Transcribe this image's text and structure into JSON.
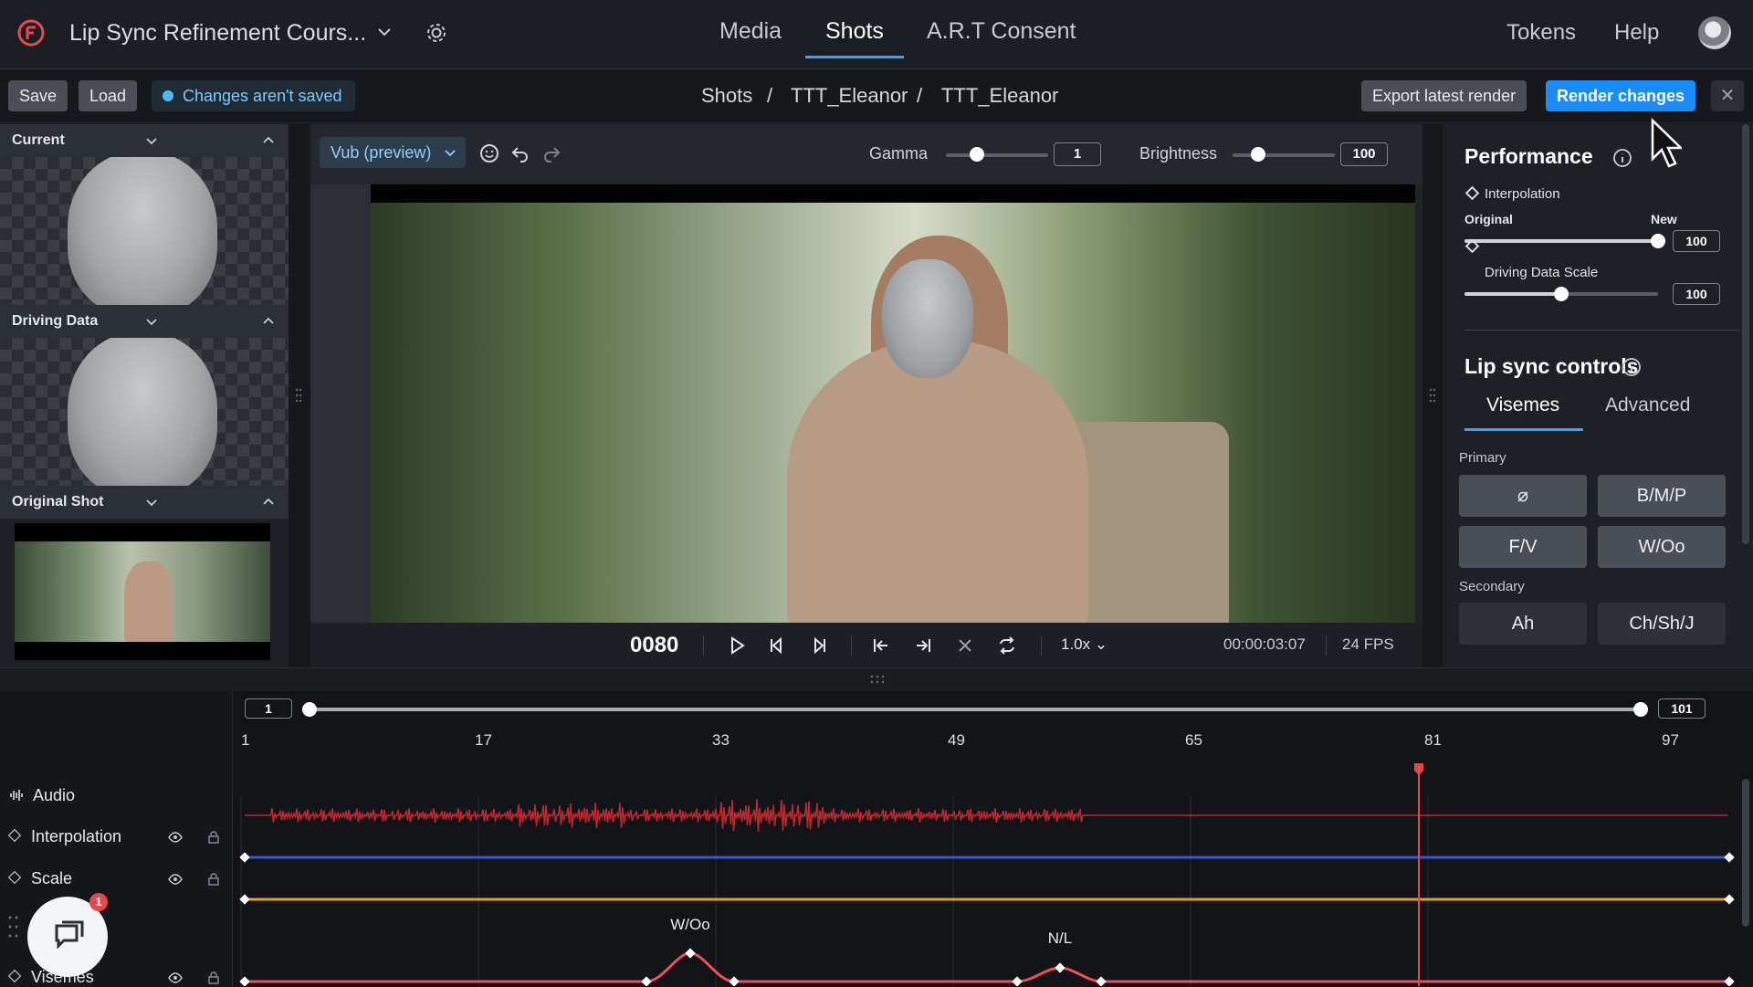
{
  "app": {
    "project_title": "Lip Sync Refinement Cours...",
    "nav_tabs": [
      "Media",
      "Shots",
      "A.R.T Consent"
    ],
    "active_tab": "Shots",
    "tokens_label": "Tokens",
    "help_label": "Help"
  },
  "toolbar": {
    "save_label": "Save",
    "load_label": "Load",
    "status_text": "Changes aren't saved",
    "breadcrumb": [
      "Shots",
      "TTT_Eleanor",
      "TTT_Eleanor"
    ],
    "breadcrumb_sep": "/",
    "export_label": "Export latest render",
    "render_label": "Render changes",
    "close_label": "✕"
  },
  "left_panel": {
    "sections": [
      "Current",
      "Driving Data",
      "Original Shot"
    ]
  },
  "viewer": {
    "mode_label": "Vub (preview)",
    "gamma_label": "Gamma",
    "gamma_value": "1",
    "gamma_level": 0.3,
    "brightness_label": "Brightness",
    "brightness_value": "100",
    "brightness_level": 0.25,
    "frame": "0080",
    "speed": "1.0x",
    "timecode": "00:00:03:07",
    "fps": "24 FPS"
  },
  "performance": {
    "title": "Performance",
    "interpolation_label": "Interpolation",
    "original_label": "Original",
    "new_label": "New",
    "interpolation_value": "100",
    "interpolation_level": 1.0,
    "driving_label": "Driving Data Scale",
    "driving_value": "100",
    "driving_level": 0.5
  },
  "lipsync": {
    "title": "Lip sync controls",
    "tabs": [
      "Visemes",
      "Advanced"
    ],
    "active_tab": "Visemes",
    "primary_label": "Primary",
    "primary_buttons": [
      "⌀",
      "B/M/P",
      "F/V",
      "W/Oo"
    ],
    "secondary_label": "Secondary",
    "secondary_buttons": [
      "Ah",
      "Ch/Sh/J"
    ]
  },
  "timeline": {
    "range_start": "1",
    "range_end": "101",
    "ticks": [
      "1",
      "17",
      "33",
      "49",
      "65",
      "81",
      "97"
    ],
    "tracks": [
      "Audio",
      "Interpolation",
      "Scale",
      "Visemes"
    ],
    "viseme_marks": [
      "W/Oo",
      "N/L"
    ],
    "notification_count": "1",
    "colors": {
      "audio": "#c0282d",
      "interpolation": "#3b55d9",
      "scale": "#e0a21f",
      "visemes": "#e8505b",
      "playhead": "#e5484d",
      "accent": "#1a8cff"
    }
  }
}
